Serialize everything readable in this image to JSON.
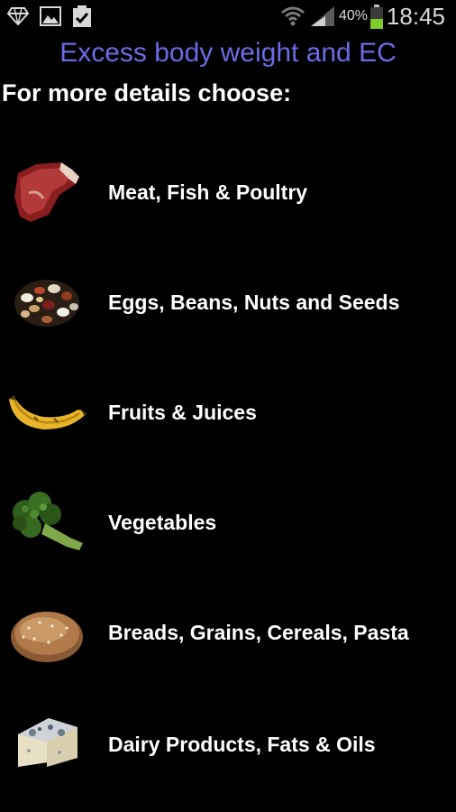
{
  "status_bar": {
    "battery_percent": "40%",
    "time": "18:45",
    "icons": [
      "diamond-icon",
      "image-icon",
      "clipboard-check-icon",
      "wifi-icon",
      "signal-icon",
      "battery-icon"
    ]
  },
  "header": {
    "title": "Excess body weight and EC",
    "title_color": "#6b6be6",
    "subtitle": "For more details choose:"
  },
  "menu": {
    "items": [
      {
        "label": "Meat, Fish & Poultry",
        "icon": "meat-icon"
      },
      {
        "label": "Eggs, Beans, Nuts and Seeds",
        "icon": "beans-icon"
      },
      {
        "label": "Fruits & Juices",
        "icon": "banana-icon"
      },
      {
        "label": "Vegetables",
        "icon": "broccoli-icon"
      },
      {
        "label": "Breads, Grains, Cereals, Pasta",
        "icon": "bread-icon"
      },
      {
        "label": "Dairy Products, Fats & Oils",
        "icon": "cheese-icon"
      }
    ]
  }
}
